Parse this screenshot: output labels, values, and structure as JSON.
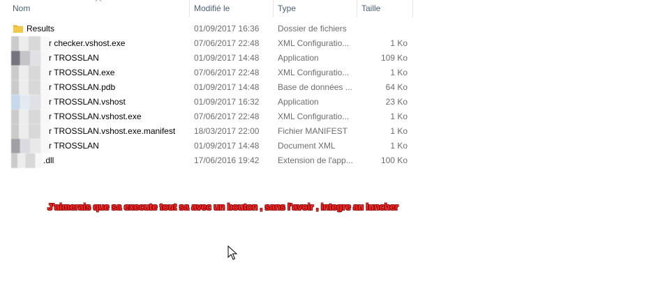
{
  "columns": {
    "name": "Nom",
    "modified": "Modifié le",
    "type": "Type",
    "size": "Taille"
  },
  "rows": [
    {
      "name": "Results",
      "modified": "01/09/2017 16:36",
      "type": "Dossier de fichiers",
      "size": "",
      "icon": "folder-icon"
    },
    {
      "name": "r checker.vshost.exe",
      "modified": "07/06/2017 22:48",
      "type": "XML Configuratio...",
      "size": "1 Ko",
      "icon": "redacted-file-icon"
    },
    {
      "name": "r TROSSLAN",
      "modified": "01/09/2017 14:48",
      "type": "Application",
      "size": "109 Ko",
      "icon": "redacted-file-icon"
    },
    {
      "name": "r TROSSLAN.exe",
      "modified": "07/06/2017 22:48",
      "type": "XML Configuratio...",
      "size": "1 Ko",
      "icon": "redacted-file-icon"
    },
    {
      "name": "r TROSSLAN.pdb",
      "modified": "01/09/2017 14:48",
      "type": "Base de données ...",
      "size": "64 Ko",
      "icon": "redacted-file-icon"
    },
    {
      "name": "r TROSSLAN.vshost",
      "modified": "01/09/2017 16:32",
      "type": "Application",
      "size": "23 Ko",
      "icon": "redacted-file-icon"
    },
    {
      "name": "r TROSSLAN.vshost.exe",
      "modified": "07/06/2017 22:48",
      "type": "XML Configuratio...",
      "size": "1 Ko",
      "icon": "redacted-file-icon"
    },
    {
      "name": "r TROSSLAN.vshost.exe.manifest",
      "modified": "18/03/2017 22:00",
      "type": "Fichier MANIFEST",
      "size": "1 Ko",
      "icon": "redacted-file-icon"
    },
    {
      "name": "r TROSSLAN",
      "modified": "01/09/2017 14:48",
      "type": "Document XML",
      "size": "1 Ko",
      "icon": "redacted-file-icon"
    },
    {
      "name": ".dll",
      "modified": "17/06/2016 19:42",
      "type": "Extension de l'app...",
      "size": "100 Ko",
      "icon": "redacted-file-icon"
    }
  ],
  "annotation": "J'aimerais que sa execute tout sa avec un bouton , sans l'avoir , integre au luncher",
  "colors": {
    "header_text": "#4c607a",
    "annotation_text": "#ff2a2a",
    "annotation_outline": "#8a0000",
    "folder": "#f3c94b"
  }
}
